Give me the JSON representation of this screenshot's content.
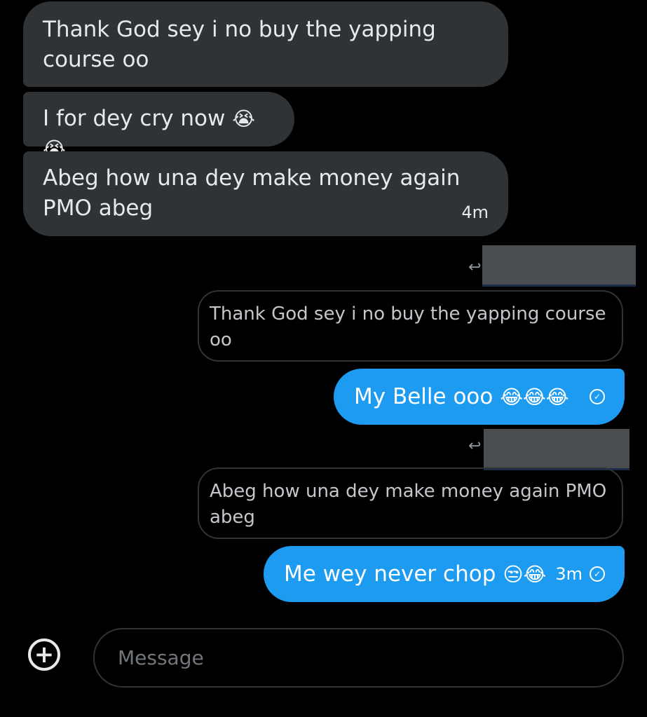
{
  "received": [
    {
      "text": "Thank God sey i no buy the yapping course oo"
    },
    {
      "text": "I for dey cry now",
      "emoji": "😭😭"
    },
    {
      "text": "Abeg how una dey make money again PMO abeg",
      "time": "4m"
    }
  ],
  "replies": [
    {
      "quoted": "Thank God sey i no buy the yapping course oo",
      "text": "My Belle ooo",
      "emoji": "😂😂😂"
    },
    {
      "quoted": "Abeg how una dey make money again PMO abeg",
      "text": "Me wey never chop",
      "emoji": "😒😂",
      "time": "3m"
    }
  ],
  "icons": {
    "reply": "↩",
    "check": "✓",
    "add": "+"
  },
  "composer": {
    "placeholder": "Message"
  },
  "colors": {
    "received_bubble": "#2f3336",
    "sent_bubble": "#1d9bf0",
    "background": "#000000"
  }
}
